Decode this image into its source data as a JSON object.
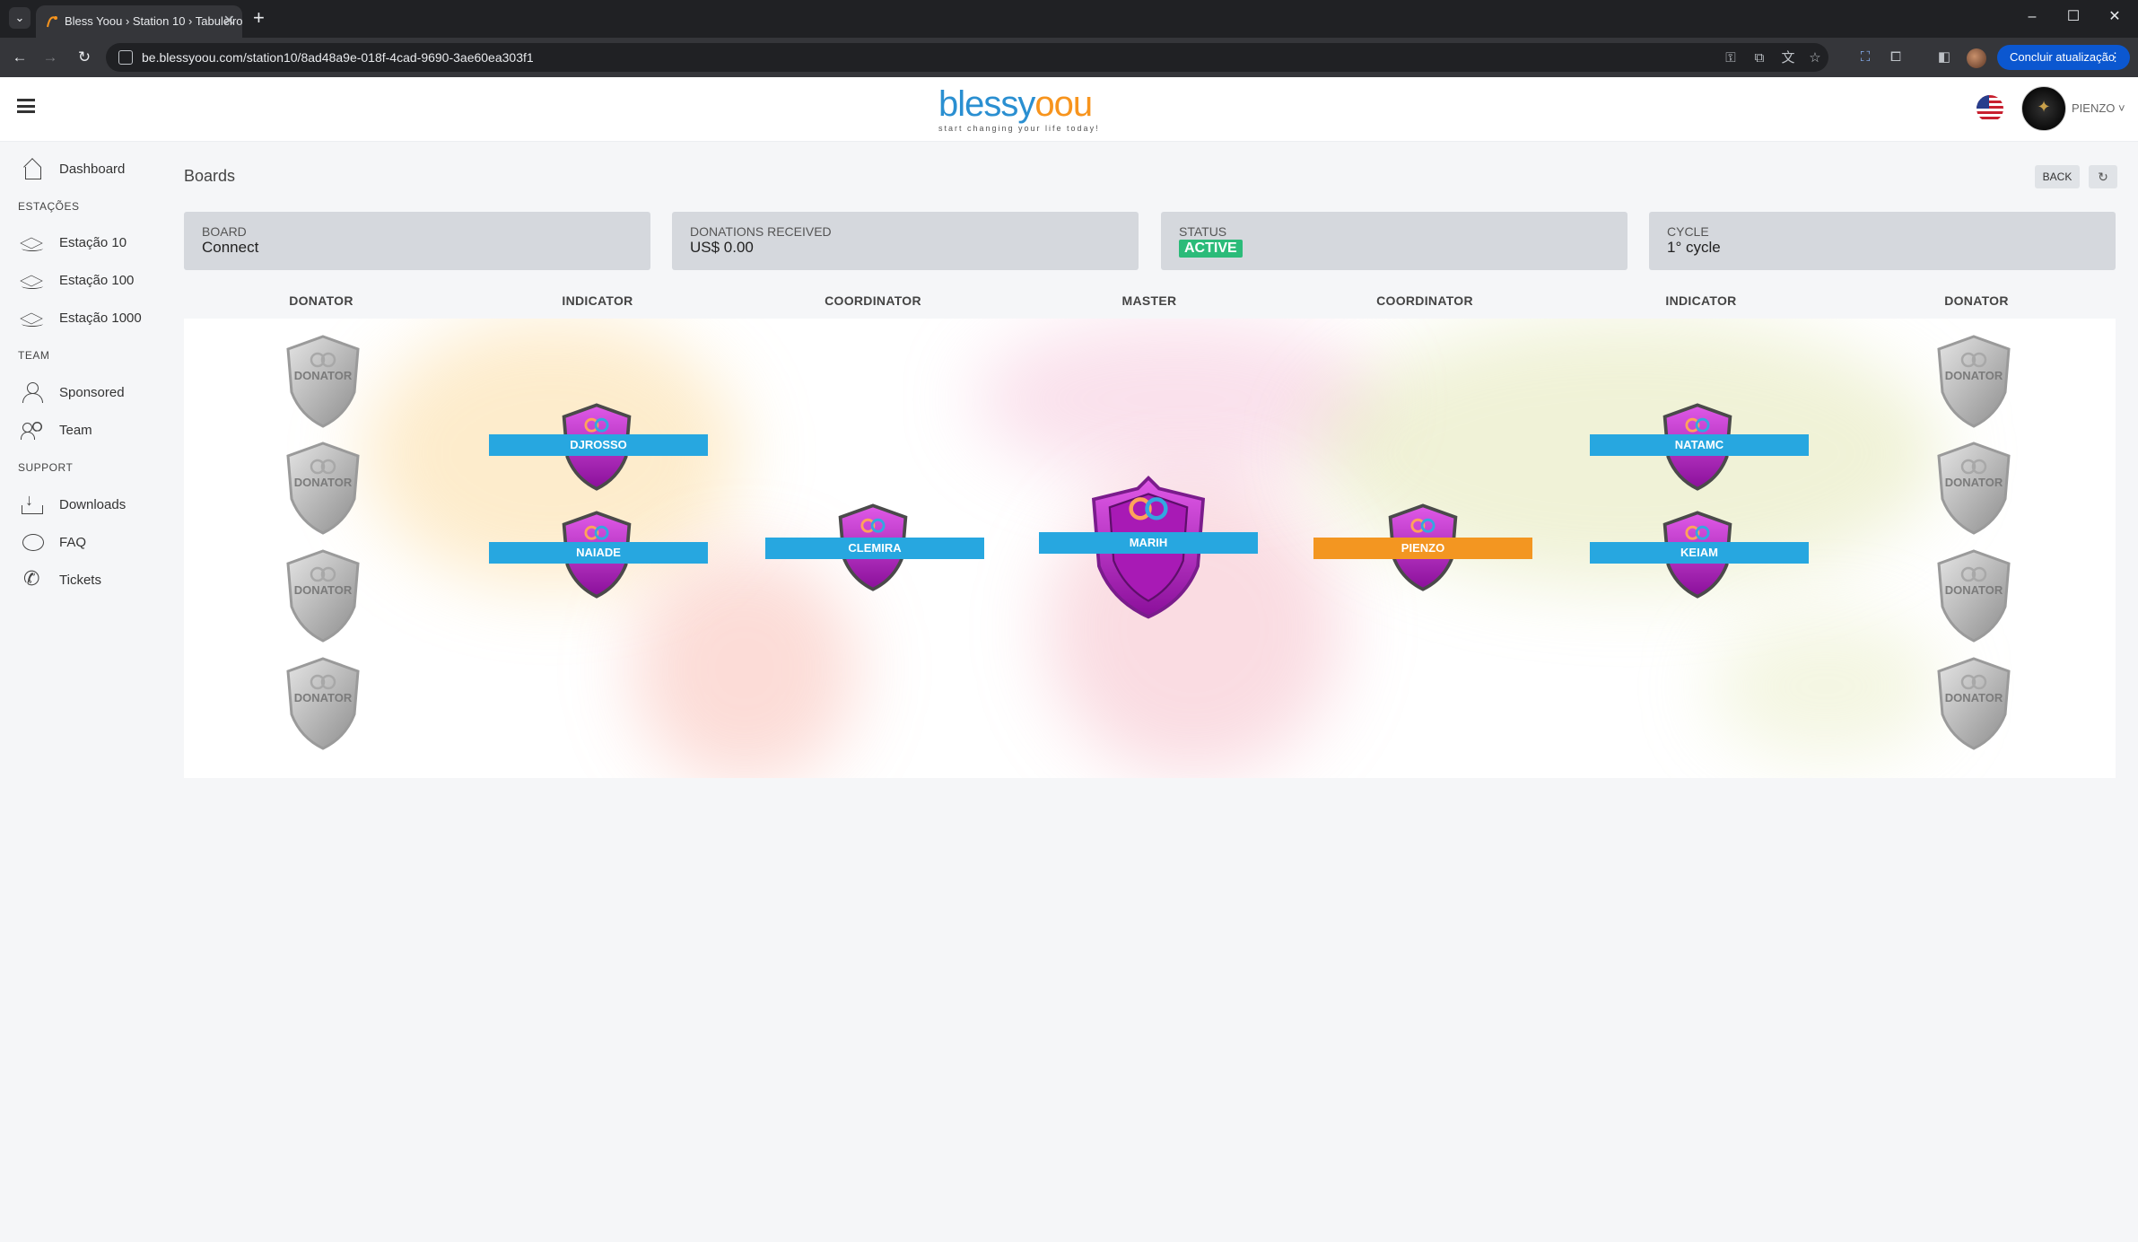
{
  "browser": {
    "tab_title": "Bless Yoou › Station 10 › Tabuleiro",
    "url": "be.blessyoou.com/station10/8ad48a9e-018f-4cad-9690-3ae60ea303f1",
    "update_label": "Concluir atualização"
  },
  "header": {
    "logo_text_1": "blessy",
    "logo_text_2": "oou",
    "logo_tagline": "start changing your life today!",
    "username": "PIENZO"
  },
  "sidebar": {
    "items": [
      {
        "label": "Dashboard",
        "icon": "home-icon"
      },
      {
        "section": "ESTAÇÕES"
      },
      {
        "label": "Estação 10",
        "icon": "layers-icon"
      },
      {
        "label": "Estação 100",
        "icon": "layers-icon"
      },
      {
        "label": "Estação 1000",
        "icon": "layers-icon"
      },
      {
        "section": "TEAM"
      },
      {
        "label": "Sponsored",
        "icon": "user-icon"
      },
      {
        "label": "Team",
        "icon": "team-icon"
      },
      {
        "section": "SUPPORT"
      },
      {
        "label": "Downloads",
        "icon": "download-icon"
      },
      {
        "label": "FAQ",
        "icon": "chat-icon"
      },
      {
        "label": "Tickets",
        "icon": "phone-icon"
      }
    ]
  },
  "page": {
    "title": "Boards",
    "back_label": "BACK"
  },
  "cards": {
    "board_label": "BOARD",
    "board_value": "Connect",
    "donations_label": "DONATIONS RECEIVED",
    "donations_value": "US$ 0.00",
    "status_label": "STATUS",
    "status_value": "ACTIVE",
    "cycle_label": "CYCLE",
    "cycle_value": "1° cycle"
  },
  "columns": [
    "DONATOR",
    "INDICATOR",
    "COORDINATOR",
    "MASTER",
    "COORDINATOR",
    "INDICATOR",
    "DONATOR"
  ],
  "slots": {
    "donator_label": "DONATOR",
    "indicators_left": [
      "DJROSSO",
      "NAIADE"
    ],
    "coordinator_left": "CLEMIRA",
    "master": "MARIH",
    "coordinator_right": "PIENZO",
    "indicators_right": [
      "NATAMC",
      "KEIAM"
    ]
  },
  "colors": {
    "name_bar": "#27a7e0",
    "name_bar_self": "#f39621",
    "status_active": "#2bbb79",
    "shield_purple": "#b61fc0"
  }
}
